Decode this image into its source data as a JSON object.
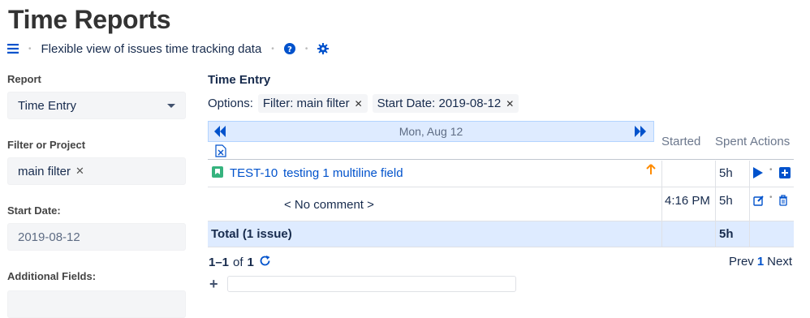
{
  "page": {
    "title": "Time Reports",
    "subtitle": "Flexible view of issues time tracking data"
  },
  "sidebar": {
    "report_label": "Report",
    "report_value": "Time Entry",
    "filter_label": "Filter or Project",
    "filter_value": "main filter",
    "start_date_label": "Start Date:",
    "start_date_value": "2019-08-12",
    "additional_fields_label": "Additional Fields:"
  },
  "report": {
    "title": "Time Entry",
    "options_label": "Options:",
    "chips": [
      "Filter: main filter",
      "Start Date: 2019-08-12"
    ],
    "date_header": "Mon, Aug 12",
    "columns": {
      "started": "Started",
      "spent": "Spent",
      "actions": "Actions"
    },
    "issue": {
      "key": "TEST-10",
      "summary": "testing 1 multiline field",
      "priority_icon": "arrow-up-icon",
      "spent": "5h"
    },
    "worklog": {
      "comment": "< No comment >",
      "started": "4:16 PM",
      "spent": "5h"
    },
    "total": {
      "label": "Total (1 issue)",
      "spent": "5h"
    }
  },
  "pager": {
    "range": "1–1",
    "of": "of",
    "total": "1",
    "prev": "Prev",
    "current": "1",
    "next": "Next"
  },
  "colors": {
    "accent": "#0052cc",
    "date_bar": "#deebff",
    "story": "#36b37e",
    "priority": "#ff8b00"
  }
}
